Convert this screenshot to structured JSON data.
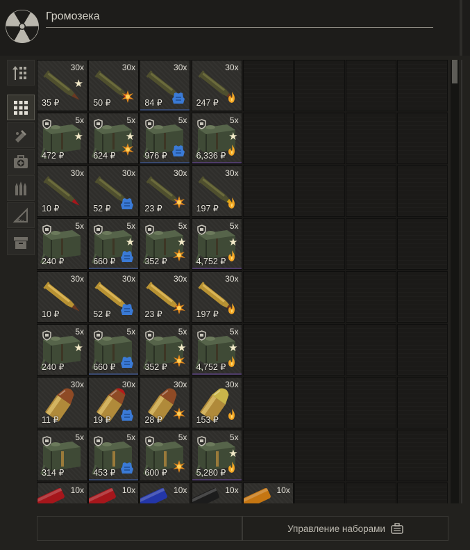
{
  "header": {
    "title": "Громозека"
  },
  "sidebar": {
    "items": [
      {
        "id": "sort",
        "icon": "sort-arrows-icon",
        "active": false
      },
      {
        "id": "all",
        "icon": "grid-icon",
        "active": true
      },
      {
        "id": "weapons",
        "icon": "weapon-mods-icon",
        "active": false
      },
      {
        "id": "medical",
        "icon": "medkit-icon",
        "active": false
      },
      {
        "id": "ammo",
        "icon": "ammo-icon",
        "active": false
      },
      {
        "id": "tools",
        "icon": "tools-icon",
        "active": false
      },
      {
        "id": "containers",
        "icon": "box-icon",
        "active": false
      }
    ]
  },
  "colors": {
    "accent": "#f2e9c8",
    "price_text": "#e8e5dc",
    "armor_badge": "#3a7ad6",
    "fire_badge": "#f5a623"
  },
  "inventory": {
    "currency": "₽",
    "items": [
      {
        "row": 0,
        "col": 0,
        "type": "rifle_round",
        "tip": "brown",
        "qty": "30x",
        "price": "35 ₽",
        "badge": "star"
      },
      {
        "row": 0,
        "col": 1,
        "type": "rifle_round",
        "tip": "red",
        "qty": "30x",
        "price": "50 ₽",
        "badge": "burst"
      },
      {
        "row": 0,
        "col": 2,
        "type": "rifle_round",
        "tip": "purple",
        "qty": "30x",
        "price": "84 ₽",
        "badge": "armor",
        "variant": "blue"
      },
      {
        "row": 0,
        "col": 3,
        "type": "rifle_round",
        "tip": "brown",
        "qty": "30x",
        "price": "247 ₽",
        "badge": "fire"
      },
      {
        "row": 1,
        "col": 0,
        "type": "ammo_pack",
        "qty": "5x",
        "price": "472 ₽",
        "badge": "star"
      },
      {
        "row": 1,
        "col": 1,
        "type": "ammo_pack",
        "qty": "5x",
        "price": "624 ₽",
        "badge": "star_burst"
      },
      {
        "row": 1,
        "col": 2,
        "type": "ammo_pack",
        "qty": "5x",
        "price": "976 ₽",
        "badge": "armor",
        "variant": "blue"
      },
      {
        "row": 1,
        "col": 3,
        "type": "ammo_pack",
        "qty": "5x",
        "price": "6,336 ₽",
        "badge": "star_fire",
        "variant": "purple"
      },
      {
        "row": 2,
        "col": 0,
        "type": "rifle_round",
        "tip": "red",
        "qty": "30x",
        "price": "10 ₽",
        "badge": "none"
      },
      {
        "row": 2,
        "col": 1,
        "type": "rifle_round",
        "tip": "black",
        "qty": "30x",
        "price": "52 ₽",
        "badge": "armor"
      },
      {
        "row": 2,
        "col": 2,
        "type": "rifle_round",
        "tip": "purple",
        "qty": "30x",
        "price": "23 ₽",
        "badge": "burst"
      },
      {
        "row": 2,
        "col": 3,
        "type": "rifle_round",
        "tip": "yellow",
        "qty": "30x",
        "price": "197 ₽",
        "badge": "fire"
      },
      {
        "row": 3,
        "col": 0,
        "type": "ammo_pack",
        "qty": "5x",
        "price": "240 ₽",
        "badge": "none"
      },
      {
        "row": 3,
        "col": 1,
        "type": "ammo_pack",
        "qty": "5x",
        "price": "660 ₽",
        "badge": "star_armor",
        "variant": "blue"
      },
      {
        "row": 3,
        "col": 2,
        "type": "ammo_pack",
        "qty": "5x",
        "price": "352 ₽",
        "badge": "star_burst"
      },
      {
        "row": 3,
        "col": 3,
        "type": "ammo_pack",
        "qty": "5x",
        "price": "4,752 ₽",
        "badge": "star_fire",
        "variant": "purple"
      },
      {
        "row": 4,
        "col": 0,
        "type": "brass_round",
        "qty": "30x",
        "price": "10 ₽",
        "badge": "none"
      },
      {
        "row": 4,
        "col": 1,
        "type": "brass_round",
        "qty": "30x",
        "price": "52 ₽",
        "badge": "armor"
      },
      {
        "row": 4,
        "col": 2,
        "type": "brass_round",
        "qty": "30x",
        "price": "23 ₽",
        "badge": "burst"
      },
      {
        "row": 4,
        "col": 3,
        "type": "brass_round",
        "qty": "30x",
        "price": "197 ₽",
        "badge": "fire"
      },
      {
        "row": 5,
        "col": 0,
        "type": "ammo_pack",
        "qty": "5x",
        "price": "240 ₽",
        "badge": "star"
      },
      {
        "row": 5,
        "col": 1,
        "type": "ammo_pack",
        "qty": "5x",
        "price": "660 ₽",
        "badge": "armor",
        "variant": "blue"
      },
      {
        "row": 5,
        "col": 2,
        "type": "ammo_pack",
        "qty": "5x",
        "price": "352 ₽",
        "badge": "star_burst"
      },
      {
        "row": 5,
        "col": 3,
        "type": "ammo_pack",
        "qty": "5x",
        "price": "4,752 ₽",
        "badge": "star_fire",
        "variant": "purple"
      },
      {
        "row": 6,
        "col": 0,
        "type": "pistol_round",
        "tip": "copper",
        "qty": "30x",
        "price": "11 ₽",
        "badge": "none"
      },
      {
        "row": 6,
        "col": 1,
        "type": "pistol_round",
        "tip": "red",
        "qty": "30x",
        "price": "19 ₽",
        "badge": "armor"
      },
      {
        "row": 6,
        "col": 2,
        "type": "pistol_round",
        "tip": "copper",
        "qty": "30x",
        "price": "28 ₽",
        "badge": "burst"
      },
      {
        "row": 6,
        "col": 3,
        "type": "pistol_round",
        "tip": "yellow",
        "qty": "30x",
        "price": "153 ₽",
        "badge": "fire"
      },
      {
        "row": 7,
        "col": 0,
        "type": "ammo_pack_small",
        "qty": "5x",
        "price": "314 ₽",
        "badge": "none"
      },
      {
        "row": 7,
        "col": 1,
        "type": "ammo_pack_small",
        "qty": "5x",
        "price": "453 ₽",
        "badge": "armor",
        "variant": "blue"
      },
      {
        "row": 7,
        "col": 2,
        "type": "ammo_pack_small",
        "qty": "5x",
        "price": "600 ₽",
        "badge": "burst"
      },
      {
        "row": 7,
        "col": 3,
        "type": "ammo_pack_small",
        "qty": "5x",
        "price": "5,280 ₽",
        "badge": "star_fire",
        "variant": "purple"
      },
      {
        "row": 8,
        "col": 0,
        "type": "shell",
        "tip": "red",
        "qty": "10x",
        "price": "",
        "badge": "none"
      },
      {
        "row": 8,
        "col": 1,
        "type": "shell",
        "tip": "red",
        "qty": "10x",
        "price": "",
        "badge": "none"
      },
      {
        "row": 8,
        "col": 2,
        "type": "shell",
        "tip": "blue",
        "qty": "10x",
        "price": "",
        "badge": "none"
      },
      {
        "row": 8,
        "col": 3,
        "type": "shell",
        "tip": "black",
        "qty": "10x",
        "price": "",
        "badge": "none"
      },
      {
        "row": 8,
        "col": 4,
        "type": "shell",
        "tip": "orange",
        "qty": "10x",
        "price": "",
        "badge": "none"
      }
    ]
  },
  "footer": {
    "manage_sets_label": "Управление наборами",
    "manage_sets_icon": "briefcase-icon"
  }
}
